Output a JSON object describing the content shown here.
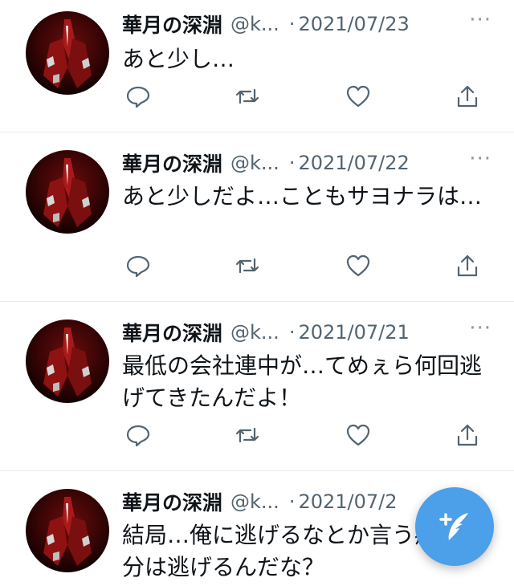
{
  "colors": {
    "accent": "#4c9fe9",
    "secondary_text": "#536471",
    "divider": "#e6e9ec"
  },
  "tweets": [
    {
      "name": "華月の深淵",
      "handle": "@k...",
      "date": "2021/07/23",
      "text": "あと少し…"
    },
    {
      "name": "華月の深淵",
      "handle": "@k...",
      "date": "2021/07/22",
      "text": "あと少しだよ…こともサヨナラは…"
    },
    {
      "name": "華月の深淵",
      "handle": "@k...",
      "date": "2021/07/21",
      "text": "最低の会社連中が…てめぇら何回逃げてきたんだよ！"
    },
    {
      "name": "華月の深淵",
      "handle": "@k...",
      "date": "2021/07/2",
      "text": "結局…俺に逃げるなとか言う癖に自分は逃げるんだな？"
    }
  ],
  "icons": {
    "reply": "reply-icon",
    "retweet": "retweet-icon",
    "like": "heart-icon",
    "share": "share-icon",
    "compose": "compose-tweet-icon",
    "more": "more-icon"
  },
  "ui": {
    "separator": "·",
    "more_glyph": "···"
  }
}
